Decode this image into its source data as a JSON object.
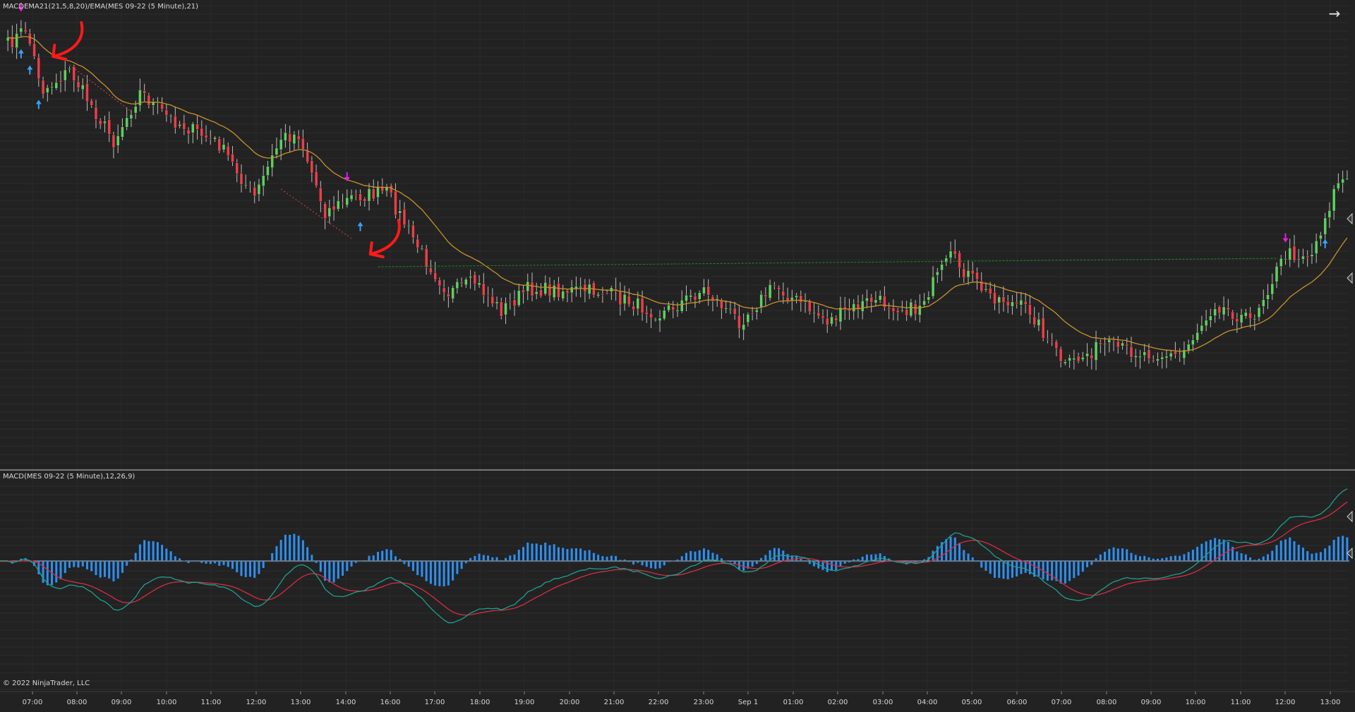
{
  "window": {
    "price_panel_label": "MACDEMA21(21,5,8,20)/EMA(MES 09-22 (5 Minute),21)",
    "macd_panel_label": "MACD(MES 09-22 (5 Minute),12,26,9)",
    "copyright": "© 2022 NinjaTrader, LLC",
    "nav_arrow_icon": "arrow-right-icon",
    "nav_arrow_glyph": "→"
  },
  "colors": {
    "background": "#222222",
    "grid": "#2c2c2c",
    "separator": "#cfcfcf",
    "candle_up": "#5fcf5f",
    "candle_down": "#e8404a",
    "wick": "#bdbdbd",
    "ema": "#c8922a",
    "macd_line": "#1f9e8e",
    "signal_line": "#d42d45",
    "histogram": "#2e8ff0",
    "signal_up_arrow": "#3aa0ff",
    "signal_down_arrow": "#e020e0",
    "annotation": "#ff1a1a",
    "level_line": "#1e8c1e"
  },
  "chart_data": {
    "type": "candlestick",
    "x_ticks": [
      "07:00",
      "08:00",
      "09:00",
      "10:00",
      "11:00",
      "12:00",
      "13:00",
      "14:00",
      "16:00",
      "17:00",
      "18:00",
      "19:00",
      "20:00",
      "21:00",
      "22:00",
      "23:00",
      "Sep 1",
      "01:00",
      "02:00",
      "03:00",
      "04:00",
      "05:00",
      "06:00",
      "07:00",
      "08:00",
      "09:00",
      "10:00",
      "11:00",
      "12:00",
      "13:00"
    ],
    "close_anchors": [
      {
        "bar": 0,
        "price": 64
      },
      {
        "bar": 4,
        "price": 40
      },
      {
        "bar": 8,
        "price": 128
      },
      {
        "bar": 14,
        "price": 100
      },
      {
        "bar": 24,
        "price": 200
      },
      {
        "bar": 30,
        "price": 130
      },
      {
        "bar": 36,
        "price": 165
      },
      {
        "bar": 48,
        "price": 205
      },
      {
        "bar": 56,
        "price": 280
      },
      {
        "bar": 62,
        "price": 195
      },
      {
        "bar": 66,
        "price": 190
      },
      {
        "bar": 72,
        "price": 300
      },
      {
        "bar": 78,
        "price": 280
      },
      {
        "bar": 86,
        "price": 272
      },
      {
        "bar": 94,
        "price": 360
      },
      {
        "bar": 100,
        "price": 415
      },
      {
        "bar": 106,
        "price": 400
      },
      {
        "bar": 112,
        "price": 440
      },
      {
        "bar": 118,
        "price": 410
      },
      {
        "bar": 135,
        "price": 413
      },
      {
        "bar": 148,
        "price": 445
      },
      {
        "bar": 158,
        "price": 410
      },
      {
        "bar": 166,
        "price": 455
      },
      {
        "bar": 174,
        "price": 405
      },
      {
        "bar": 186,
        "price": 455
      },
      {
        "bar": 196,
        "price": 425
      },
      {
        "bar": 206,
        "price": 440
      },
      {
        "bar": 214,
        "price": 365
      },
      {
        "bar": 222,
        "price": 415
      },
      {
        "bar": 232,
        "price": 440
      },
      {
        "bar": 240,
        "price": 520
      },
      {
        "bar": 248,
        "price": 490
      },
      {
        "bar": 258,
        "price": 500
      },
      {
        "bar": 266,
        "price": 505
      },
      {
        "bar": 274,
        "price": 430
      },
      {
        "bar": 282,
        "price": 455
      },
      {
        "bar": 290,
        "price": 360
      },
      {
        "bar": 296,
        "price": 360
      },
      {
        "bar": 302,
        "price": 255
      },
      {
        "bar": 304,
        "price": 255
      }
    ],
    "ema_period": 21,
    "macd": {
      "fast": 12,
      "slow": 26,
      "signal": 9
    },
    "signals": [
      {
        "bar": 3,
        "dir": "up"
      },
      {
        "bar": 5,
        "dir": "up"
      },
      {
        "bar": 7,
        "dir": "up"
      },
      {
        "bar": 3,
        "dir": "down"
      },
      {
        "bar": 77,
        "dir": "down"
      },
      {
        "bar": 80,
        "dir": "up"
      },
      {
        "bar": 290,
        "dir": "down"
      },
      {
        "bar": 299,
        "dir": "up"
      }
    ],
    "level_line": {
      "from_bar": 84,
      "to_bar": 288,
      "price": 300
    },
    "annotations": [
      {
        "tip_bar": 9,
        "tip_price": 70
      },
      {
        "tip_bar": 81,
        "tip_price": 300
      }
    ]
  }
}
